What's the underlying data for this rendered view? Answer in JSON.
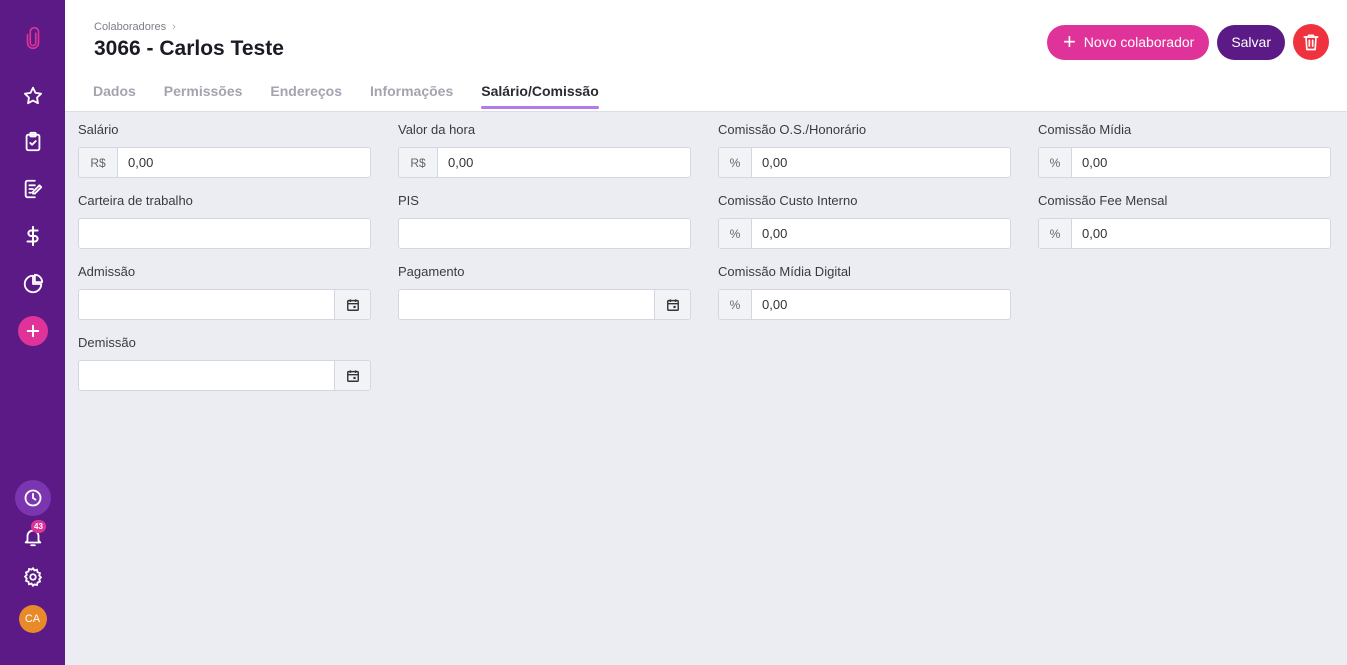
{
  "sidebar": {
    "notifications_count": "43",
    "avatar_initials": "CA",
    "icons": [
      "paperclip-logo-icon",
      "star-icon",
      "clipboard-check-icon",
      "edit-document-icon",
      "dollar-icon",
      "pie-chart-icon",
      "plus-icon",
      "clock-icon",
      "bell-icon",
      "gear-icon"
    ]
  },
  "header": {
    "breadcrumb": "Colaboradores",
    "title": "3066 - Carlos Teste",
    "new_button": "Novo colaborador",
    "save_button": "Salvar"
  },
  "tabs": [
    "Dados",
    "Permissões",
    "Endereços",
    "Informações",
    "Salário/Comissão"
  ],
  "active_tab": "Salário/Comissão",
  "form": {
    "salario": {
      "label": "Salário",
      "prefix": "R$",
      "value": "0,00"
    },
    "valor_hora": {
      "label": "Valor da hora",
      "prefix": "R$",
      "value": "0,00"
    },
    "comissao_os": {
      "label": "Comissão O.S./Honorário",
      "prefix": "%",
      "value": "0,00"
    },
    "comissao_midia": {
      "label": "Comissão Mídia",
      "prefix": "%",
      "value": "0,00"
    },
    "carteira": {
      "label": "Carteira de trabalho",
      "value": ""
    },
    "pis": {
      "label": "PIS",
      "value": ""
    },
    "comissao_custo": {
      "label": "Comissão Custo Interno",
      "prefix": "%",
      "value": "0,00"
    },
    "comissao_fee": {
      "label": "Comissão Fee Mensal",
      "prefix": "%",
      "value": "0,00"
    },
    "admissao": {
      "label": "Admissão",
      "value": ""
    },
    "pagamento": {
      "label": "Pagamento",
      "value": ""
    },
    "comissao_digital": {
      "label": "Comissão Mídia Digital",
      "prefix": "%",
      "value": "0,00"
    },
    "demissao": {
      "label": "Demissão",
      "value": ""
    }
  },
  "colors": {
    "sidebar": "#5b1a86",
    "accent_pink": "#e0339a",
    "danger": "#f0313e",
    "tab_underline": "#b27be6"
  }
}
